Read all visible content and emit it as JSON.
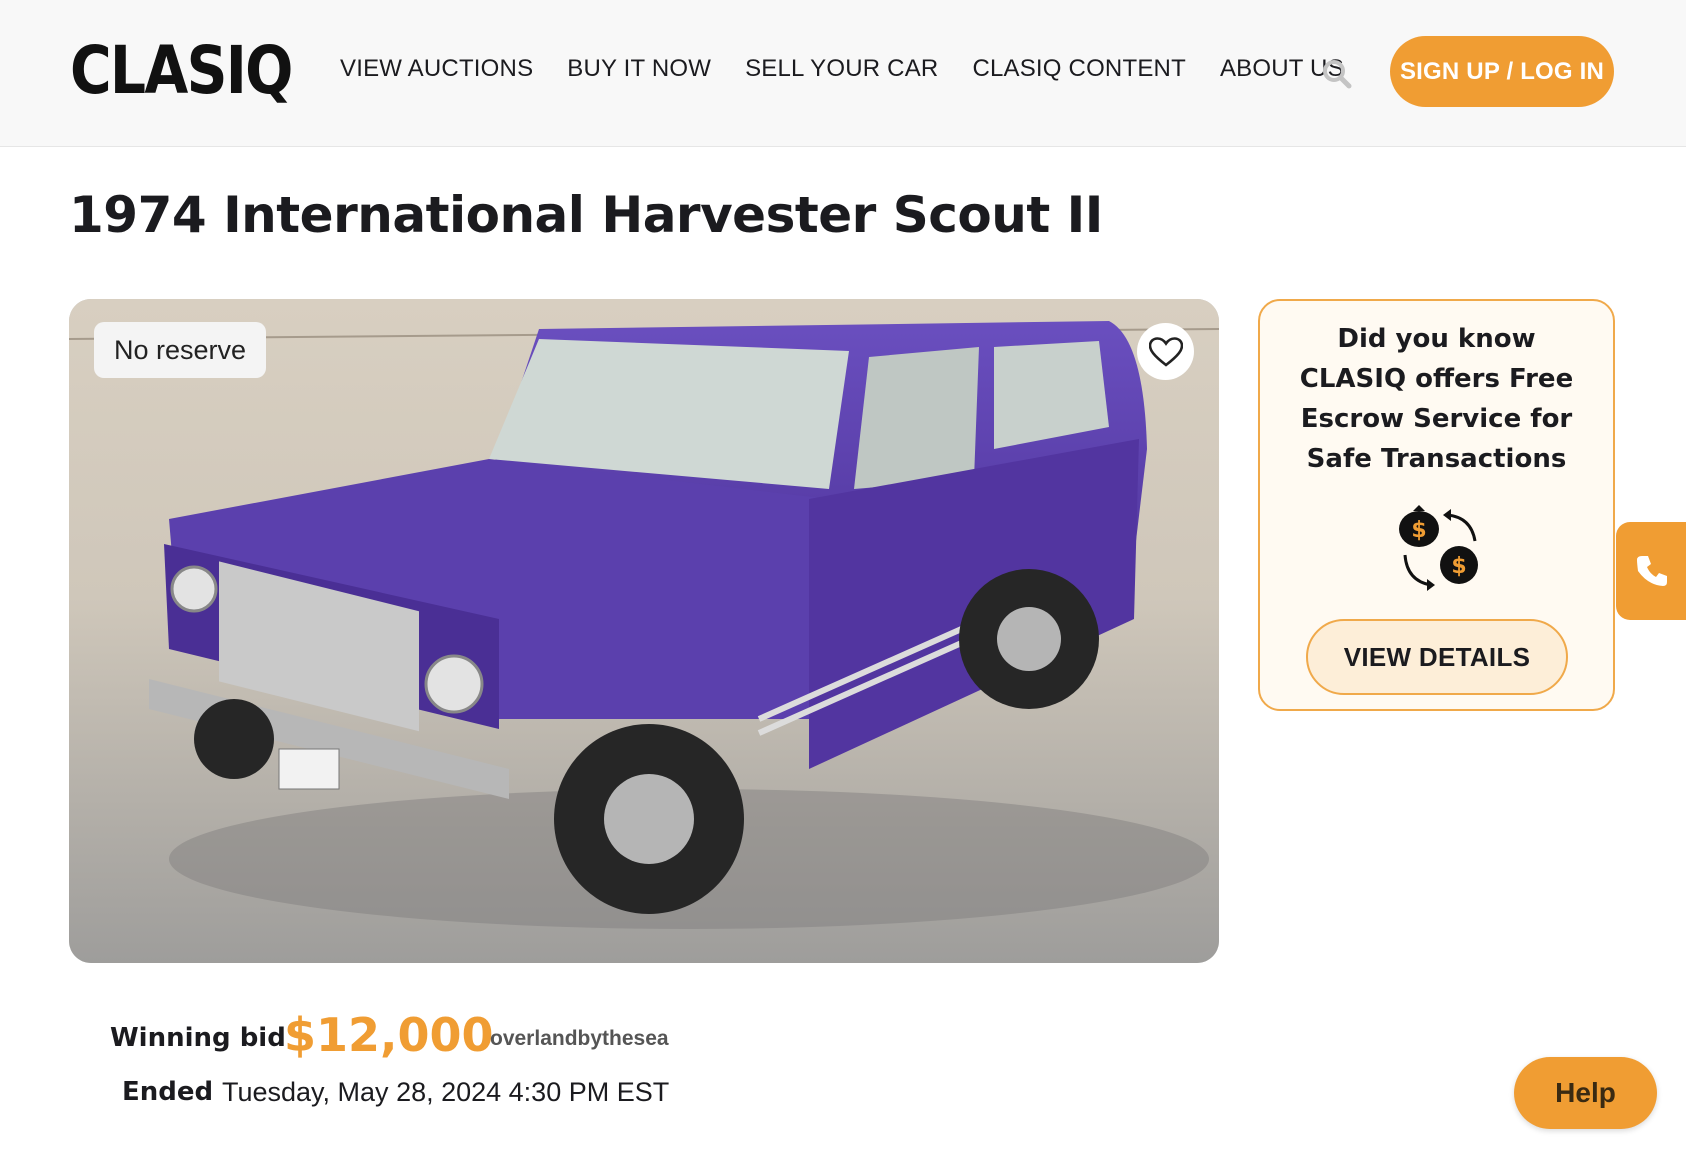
{
  "header": {
    "logo": "CLASIQ",
    "nav": [
      "VIEW AUCTIONS",
      "BUY IT NOW",
      "SELL YOUR CAR",
      "CLASIQ CONTENT",
      "ABOUT US"
    ],
    "signup_label": "SIGN UP / LOG IN",
    "search_icon": "search-icon"
  },
  "listing": {
    "title": "1974 International Harvester Scout II",
    "badge": "No reserve",
    "favorite_icon": "heart-icon",
    "photo_alt": "Purple International Harvester Scout II",
    "bid_label": "Winning bid",
    "bid_amount": "$12,000",
    "bid_user": "overlandbythesea",
    "ended_label": "Ended",
    "ended_value": "Tuesday, May 28, 2024 4:30 PM EST"
  },
  "escrow_card": {
    "text": "Did you know CLASIQ offers Free Escrow Service for Safe Transactions",
    "icon": "money-exchange-icon",
    "button_label": "VIEW DETAILS"
  },
  "floating": {
    "phone_icon": "phone-icon",
    "help_label": "Help"
  },
  "colors": {
    "accent": "#f09d33",
    "card_border": "#f0a94a",
    "card_bg": "#fffaf2",
    "vehicle": "#5a3ea6"
  }
}
